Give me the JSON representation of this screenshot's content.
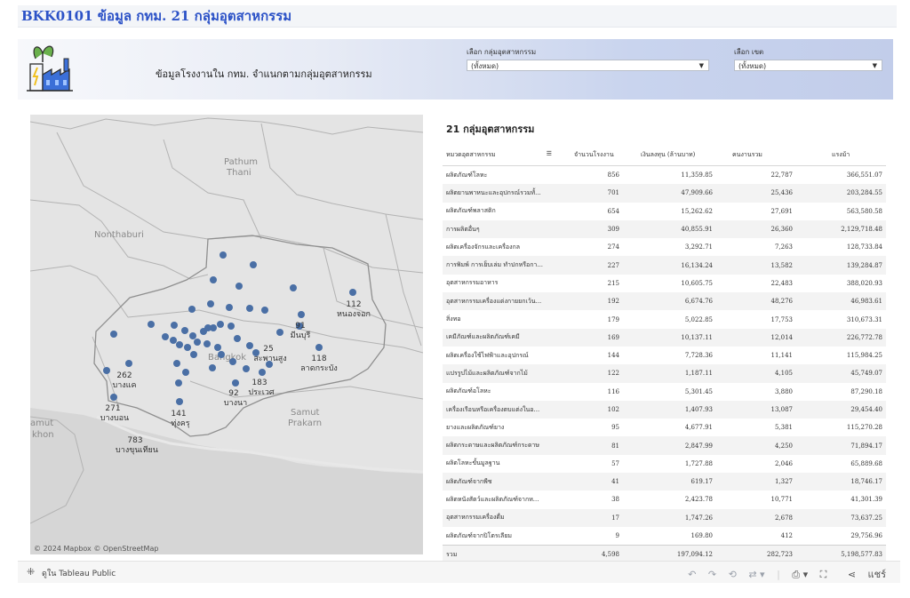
{
  "page": {
    "title": "BKK0101 ข้อมูล กทม. 21 กลุ่มอุตสาหกรรม"
  },
  "banner": {
    "subtitle": "ข้อมูลโรงงานใน กทม. จำแนกตามกลุ่มอุตสาหกรรม"
  },
  "filters": {
    "group": {
      "label": "เลือก กลุ่มอุตสาหกรรม",
      "value": "(ทั้งหมด)"
    },
    "district": {
      "label": "เลือก เขต",
      "value": "(ทั้งหมด)"
    }
  },
  "map": {
    "attribution": "© 2024 Mapbox © OpenStreetMap",
    "place_labels": [
      "Pathum",
      "Thani",
      "Nonthaburi",
      "Bangkok",
      "Samut",
      "Prakarn",
      "amut",
      "khon"
    ],
    "callouts": [
      {
        "count": "112",
        "name": "หนองจอก"
      },
      {
        "count": "91",
        "name": "มีนบุรี"
      },
      {
        "count": "25",
        "name": "สะพานสูง"
      },
      {
        "count": "118",
        "name": "ลาดกระบัง"
      },
      {
        "count": "262",
        "name": "บางแค"
      },
      {
        "count": "271",
        "name": "บางบอน"
      },
      {
        "count": "141",
        "name": "ทุ่งครุ"
      },
      {
        "count": "92",
        "name": "บางนา"
      },
      {
        "count": "183",
        "name": "ประเวศ"
      },
      {
        "count": "783",
        "name": "บางขุนเทียน"
      }
    ]
  },
  "table": {
    "title": "21 กลุ่มอุตสาหกรรม",
    "headers": [
      "หมวดอุตสาหกรรม",
      "จำนวนโรงงาน",
      "เงินลงทุน (ล้านบาท)",
      "คนงานรวม",
      "แรงม้า"
    ],
    "rows": [
      [
        "ผลิตภัณฑ์โลหะ",
        "856",
        "11,359.85",
        "22,787",
        "366,551.07"
      ],
      [
        "ผลิตยานพาหนะและอุปกรณ์รวมทั้...",
        "701",
        "47,909.66",
        "25,436",
        "203,284.55"
      ],
      [
        "ผลิตภัณฑ์พลาสติก",
        "654",
        "15,262.62",
        "27,691",
        "563,580.58"
      ],
      [
        "การผลิตอื่นๆ",
        "309",
        "40,855.91",
        "26,360",
        "2,129,718.48"
      ],
      [
        "ผลิตเครื่องจักรและเครื่องกล",
        "274",
        "3,292.71",
        "7,263",
        "128,733.84"
      ],
      [
        "การพิมพ์ การเย็บเล่ม ทำปกหรือกา...",
        "227",
        "16,134.24",
        "13,582",
        "139,284.87"
      ],
      [
        "อุตสาหกรรมอาหาร",
        "215",
        "10,605.75",
        "22,483",
        "388,020.93"
      ],
      [
        "อุตสาหกรรมเครื่องแต่งกายยกเว้น...",
        "192",
        "6,674.76",
        "48,276",
        "46,983.61"
      ],
      [
        "สิ่งทอ",
        "179",
        "5,022.85",
        "17,753",
        "310,673.31"
      ],
      [
        "เคมีภัณฑ์และผลิตภัณฑ์เคมี",
        "169",
        "10,137.11",
        "12,014",
        "226,772.78"
      ],
      [
        "ผลิตเครื่องใช้ไฟฟ้าและอุปกรณ์",
        "144",
        "7,728.36",
        "11,141",
        "115,984.25"
      ],
      [
        "แปรรูปไม้และผลิตภัณฑ์จากไม้",
        "122",
        "1,187.11",
        "4,105",
        "45,749.07"
      ],
      [
        "ผลิตภัณฑ์อโลหะ",
        "116",
        "5,301.45",
        "3,880",
        "87,290.18"
      ],
      [
        "เครื่องเรือนหรือเครื่องตบแต่งในอ...",
        "102",
        "1,407.93",
        "13,087",
        "29,454.40"
      ],
      [
        "ยางและผลิตภัณฑ์ยาง",
        "95",
        "4,677.91",
        "5,381",
        "115,270.28"
      ],
      [
        "ผลิตกระดาษและผลิตภัณฑ์กระดาษ",
        "81",
        "2,847.99",
        "4,250",
        "71,894.17"
      ],
      [
        "ผลิตโลหะขั้นมูลฐาน",
        "57",
        "1,727.88",
        "2,046",
        "65,889.68"
      ],
      [
        "ผลิตภัณฑ์จากพืช",
        "41",
        "619.17",
        "1,327",
        "18,746.17"
      ],
      [
        "ผลิตหนังสัตว์และผลิตภัณฑ์จากห...",
        "38",
        "2,423.78",
        "10,771",
        "41,301.39"
      ],
      [
        "อุตสาหกรรมเครื่องดื่ม",
        "17",
        "1,747.26",
        "2,678",
        "73,637.25"
      ],
      [
        "ผลิตภัณฑ์จากปิโตรเลียม",
        "9",
        "169.80",
        "412",
        "29,756.96"
      ]
    ],
    "total": [
      "รวม",
      "4,598",
      "197,094.12",
      "282,723",
      "5,198,577.83"
    ]
  },
  "toolbar": {
    "view_label": "ดูใน Tableau Public",
    "share_label": "แชร์",
    "icons": [
      "undo-icon",
      "redo-icon",
      "revert-icon",
      "refresh-icon",
      "download-icon",
      "fullscreen-icon",
      "share-icon"
    ]
  },
  "colors": {
    "accent": "#2c52c7",
    "dot": "#4a6fa5"
  }
}
